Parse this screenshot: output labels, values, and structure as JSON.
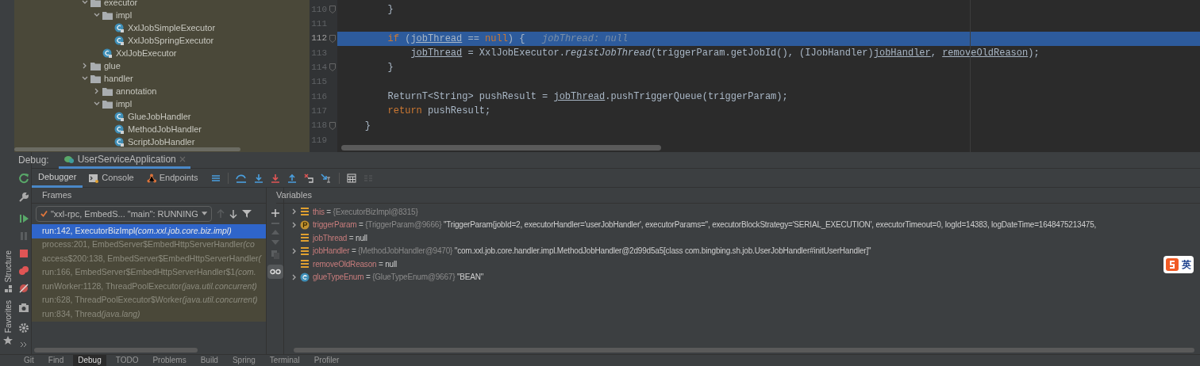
{
  "project_tree": [
    {
      "label": "executor",
      "kind": "folder",
      "expanded": true,
      "children": [
        {
          "label": "impl",
          "kind": "folder",
          "expanded": true,
          "children": [
            {
              "label": "XxlJobSimpleExecutor",
              "kind": "class"
            },
            {
              "label": "XxlJobSpringExecutor",
              "kind": "class"
            }
          ]
        },
        {
          "label": "XxlJobExecutor",
          "kind": "class"
        }
      ]
    },
    {
      "label": "glue",
      "kind": "folder",
      "expanded": false
    },
    {
      "label": "handler",
      "kind": "folder",
      "expanded": true,
      "children": [
        {
          "label": "annotation",
          "kind": "folder",
          "expanded": false
        },
        {
          "label": "impl",
          "kind": "folder",
          "expanded": true,
          "children": [
            {
              "label": "GlueJobHandler",
              "kind": "class"
            },
            {
              "label": "MethodJobHandler",
              "kind": "class"
            },
            {
              "label": "ScriptJobHandler",
              "kind": "class"
            }
          ]
        }
      ]
    }
  ],
  "editor": {
    "lines": [
      {
        "number": "110",
        "highlighted": false,
        "fold": true,
        "tokens": [
          {
            "kind": "plain",
            "text": "        }"
          }
        ]
      },
      {
        "number": "111",
        "highlighted": false,
        "fold": false
      },
      {
        "number": "112",
        "highlighted": true,
        "fold": true,
        "tokens": [
          {
            "kind": "kw",
            "text": "        if "
          },
          {
            "kind": "plain",
            "text": "("
          },
          {
            "kind": "var",
            "text": "jobThread"
          },
          {
            "kind": "plain",
            "text": " == "
          },
          {
            "kind": "kw",
            "text": "null"
          },
          {
            "kind": "plain",
            "text": ") {   "
          },
          {
            "kind": "hint",
            "text": "jobThread: null"
          }
        ]
      },
      {
        "number": "113",
        "highlighted": false,
        "fold": false,
        "tokens": [
          {
            "kind": "var",
            "text": "            jobThread"
          },
          {
            "kind": "plain",
            "text": " = XxlJobExecutor."
          },
          {
            "kind": "italic",
            "text": "registJobThread"
          },
          {
            "kind": "plain",
            "text": "(triggerParam.getJobId(), (IJobHandler)"
          },
          {
            "kind": "var",
            "text": "jobHandler"
          },
          {
            "kind": "plain",
            "text": ", "
          },
          {
            "kind": "var",
            "text": "removeOldReason"
          },
          {
            "kind": "plain",
            "text": ");"
          }
        ]
      },
      {
        "number": "114",
        "highlighted": false,
        "fold": true,
        "tokens": [
          {
            "kind": "plain",
            "text": "        }"
          }
        ]
      },
      {
        "number": "115",
        "highlighted": false,
        "fold": false
      },
      {
        "number": "116",
        "highlighted": false,
        "fold": false,
        "tokens": [
          {
            "kind": "plain",
            "text": "        ReturnT<String> pushResult = "
          },
          {
            "kind": "var",
            "text": "jobThread"
          },
          {
            "kind": "plain",
            "text": ".pushTriggerQueue(triggerParam);"
          }
        ]
      },
      {
        "number": "117",
        "highlighted": false,
        "fold": false,
        "tokens": [
          {
            "kind": "kw",
            "text": "        return "
          },
          {
            "kind": "plain",
            "text": "pushResult;"
          }
        ]
      },
      {
        "number": "118",
        "highlighted": false,
        "fold": true,
        "tokens": [
          {
            "kind": "plain",
            "text": "    }"
          }
        ]
      },
      {
        "number": "119",
        "highlighted": false,
        "fold": false
      }
    ]
  },
  "debug": {
    "label": "Debug:",
    "session_tab": "UserServiceApplication",
    "tabs": [
      {
        "label": "Debugger",
        "selected": true,
        "kind": "debugger"
      },
      {
        "label": "Console",
        "selected": false,
        "kind": "console"
      },
      {
        "label": "Endpoints",
        "selected": false,
        "kind": "endpoints"
      }
    ],
    "frames_title": "Frames",
    "variables_title": "Variables",
    "thread": "\"xxl-rpc, EmbedS... \"main\": RUNNING",
    "frames": [
      {
        "location": "run:142, ExecutorBizImpl",
        "package": "(com.xxl.job.core.biz.impl)",
        "selected": true
      },
      {
        "location": "process:201, EmbedServer$EmbedHttpServerHandler",
        "package": "(co",
        "selected": false
      },
      {
        "location": "access$200:138, EmbedServer$EmbedHttpServerHandler",
        "package": "(",
        "selected": false
      },
      {
        "location": "run:166, EmbedServer$EmbedHttpServerHandler$1",
        "package": "(com.",
        "selected": false
      },
      {
        "location": "runWorker:1128, ThreadPoolExecutor",
        "package": "(java.util.concurrent)",
        "selected": false
      },
      {
        "location": "run:628, ThreadPoolExecutor$Worker",
        "package": "(java.util.concurrent)",
        "selected": false
      },
      {
        "location": "run:834, Thread",
        "package": "(java.lang)",
        "selected": false
      }
    ],
    "variables": [
      {
        "name": "this",
        "operator": "=",
        "kind": "object",
        "expandable": true,
        "type": "{ExecutorBizImpl@8315}"
      },
      {
        "name": "triggerParam",
        "operator": "=",
        "kind": "param",
        "expandable": true,
        "type": "{TriggerParam@9666}",
        "value": "\"TriggerParam{jobId=2, executorHandler='userJobHandler', executorParams='', executorBlockStrategy='SERIAL_EXECUTION', executorTimeout=0, logId=14383, logDateTime=1648475213475,"
      },
      {
        "name": "jobThread",
        "operator": "=",
        "kind": "object",
        "expandable": false,
        "value": "null"
      },
      {
        "name": "jobHandler",
        "operator": "=",
        "kind": "object",
        "expandable": true,
        "type": "{MethodJobHandler@9470}",
        "value": "\"com.xxl.job.core.handler.impl.MethodJobHandler@2d99d5a5[class com.bingbing.sh.job.UserJobHandler#initUserHandler]\""
      },
      {
        "name": "removeOldReason",
        "operator": "=",
        "kind": "object",
        "expandable": false,
        "value": "null"
      },
      {
        "name": "glueTypeEnum",
        "operator": "=",
        "kind": "enum",
        "expandable": true,
        "type": "{GlueTypeEnum@9667}",
        "value": "\"BEAN\""
      }
    ]
  },
  "side_labels": [
    "Structure",
    "Favorites"
  ],
  "ime": {
    "label": "英"
  },
  "tool_windows": [
    {
      "label": "Git",
      "selected": false
    },
    {
      "label": "Find",
      "selected": false
    },
    {
      "label": "Debug",
      "selected": true
    },
    {
      "label": "TODO",
      "selected": false
    },
    {
      "label": "Problems",
      "selected": false
    },
    {
      "label": "Build",
      "selected": false
    },
    {
      "label": "Spring",
      "selected": false
    },
    {
      "label": "Terminal",
      "selected": false
    },
    {
      "label": "Profiler",
      "selected": false
    }
  ]
}
